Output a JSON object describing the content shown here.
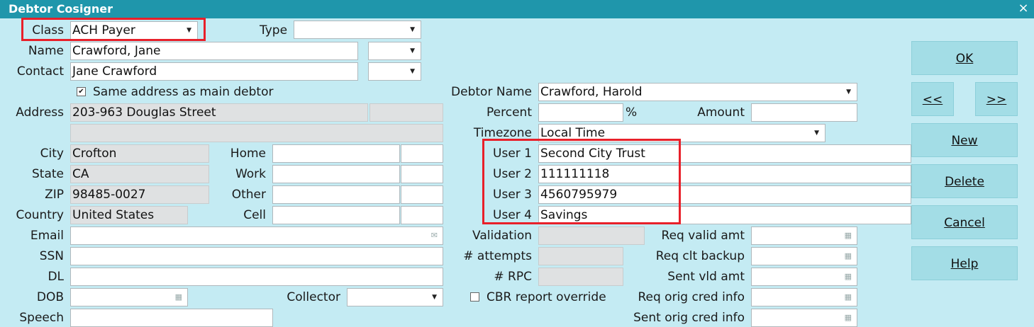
{
  "window": {
    "title": "Debtor Cosigner",
    "close_glyph": "×"
  },
  "left": {
    "class_label": "Class",
    "class_value": "ACH Payer",
    "type_label": "Type",
    "type_value": "",
    "name_label": "Name",
    "name_value": "Crawford, Jane",
    "contact_label": "Contact",
    "contact_value": "Jane Crawford",
    "same_address_label": "Same address as main debtor",
    "same_address_checked": true,
    "address_label": "Address",
    "address_line1": "203-963 Douglas Street",
    "address_line2": "",
    "city_label": "City",
    "city_value": "Crofton",
    "state_label": "State",
    "state_value": "CA",
    "zip_label": "ZIP",
    "zip_value": "98485-0027",
    "country_label": "Country",
    "country_value": "United States",
    "email_label": "Email",
    "ssn_label": "SSN",
    "dl_label": "DL",
    "dob_label": "DOB",
    "speech_label": "Speech",
    "home_label": "Home",
    "work_label": "Work",
    "other_label": "Other",
    "cell_label": "Cell",
    "collector_label": "Collector"
  },
  "right": {
    "debtor_name_label": "Debtor Name",
    "debtor_name_value": "Crawford, Harold",
    "percent_label": "Percent",
    "percent_sign": "%",
    "amount_label": "Amount",
    "timezone_label": "Timezone",
    "timezone_value": "Local Time",
    "user1_label": "User 1",
    "user1_value": "Second City Trust",
    "user2_label": "User 2",
    "user2_value": "111111118",
    "user3_label": "User 3",
    "user3_value": "4560795979",
    "user4_label": "User 4",
    "user4_value": "Savings",
    "validation_label": "Validation",
    "attempts_label": "# attempts",
    "rpc_label": "# RPC",
    "cbr_label": "CBR report override",
    "req_valid_amt_label": "Req valid amt",
    "req_clt_backup_label": "Req clt backup",
    "sent_vld_amt_label": "Sent vld amt",
    "req_orig_cred_label": "Req orig cred info",
    "sent_orig_cred_label": "Sent orig cred info"
  },
  "buttons": {
    "ok": "OK",
    "prev": "<<",
    "next": ">>",
    "new": "New",
    "delete": "Delete",
    "cancel": "Cancel",
    "help": "Help"
  },
  "icons": {
    "dropdown": "chevron-down-icon",
    "email": "envelope-icon",
    "calendar": "calendar-icon",
    "close": "close-icon"
  },
  "colors": {
    "titlebar": "#1f96ab",
    "background": "#c4ebf3",
    "button": "#a3dde6",
    "highlight": "#e8202a"
  }
}
